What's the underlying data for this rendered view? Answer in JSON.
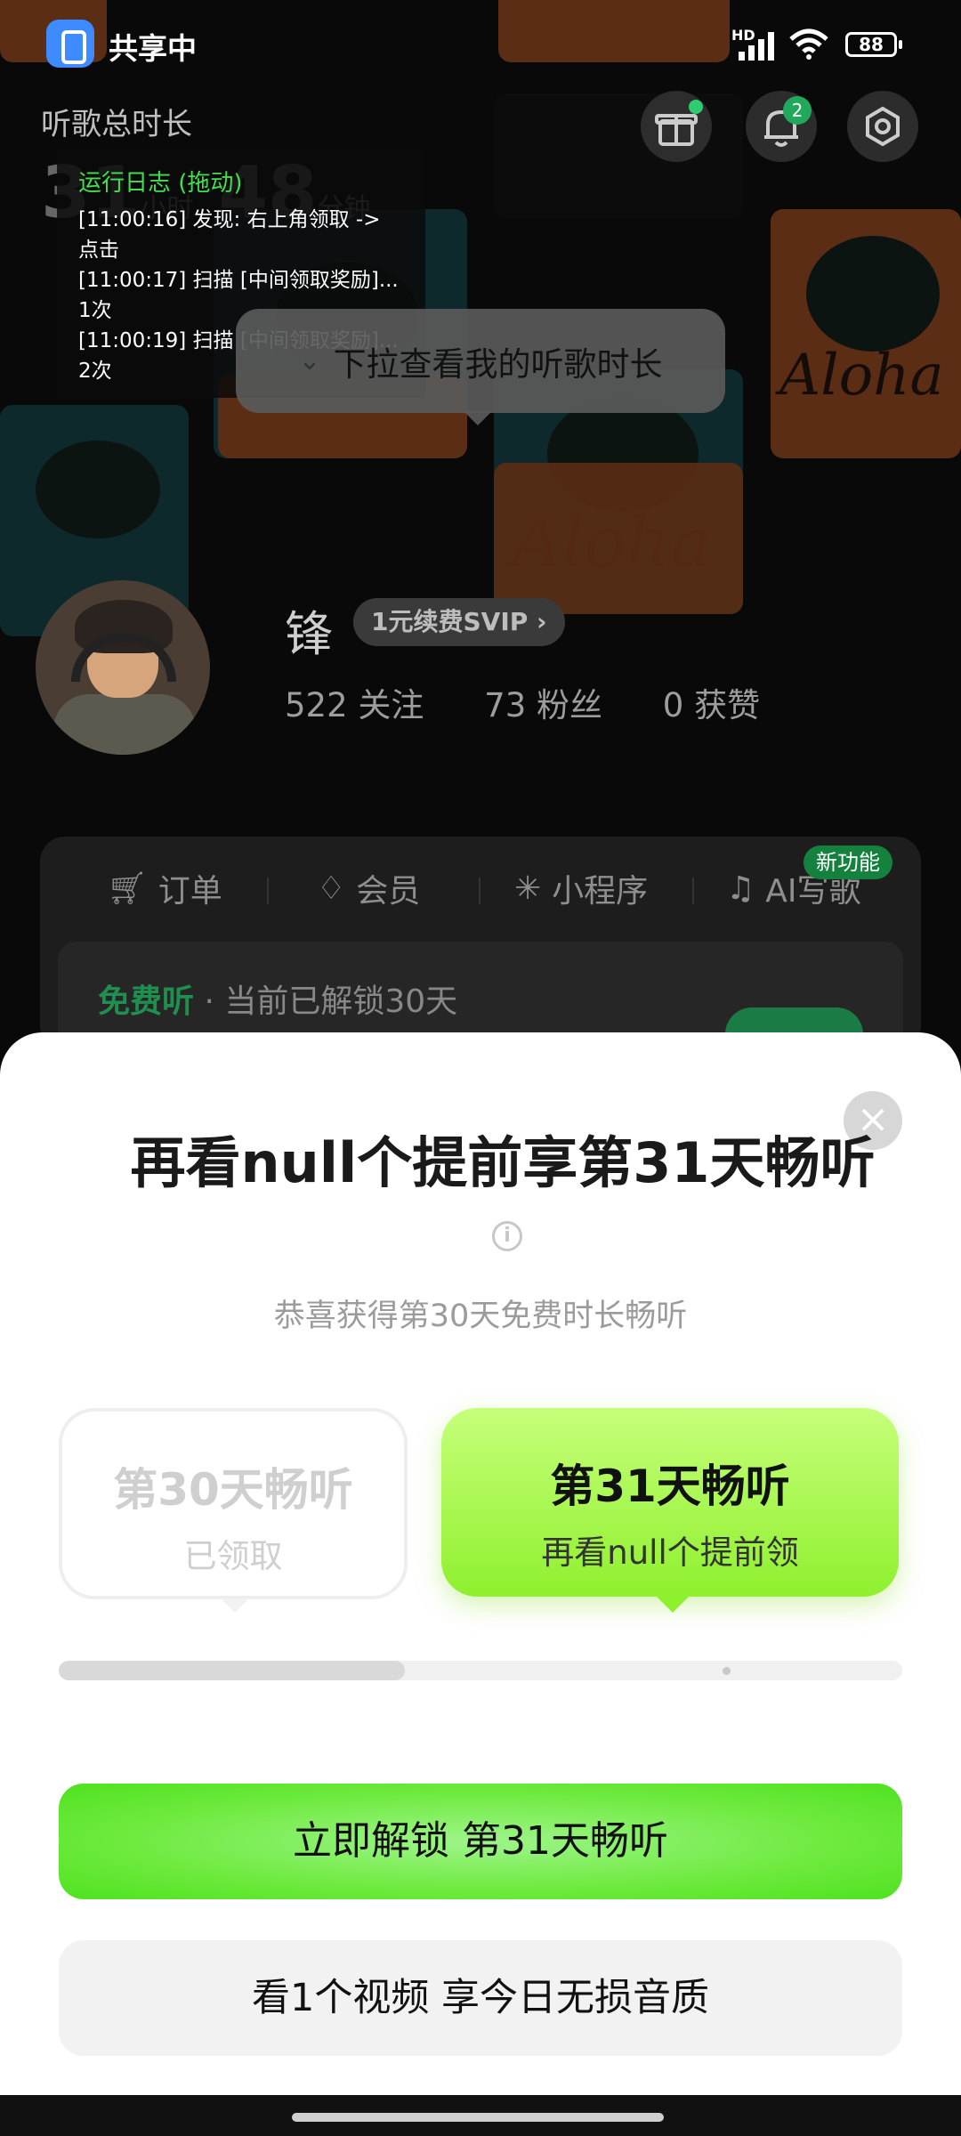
{
  "status_bar": {
    "share_label": "共享中",
    "network": "HD",
    "battery": "88"
  },
  "header": {
    "listen_title": "听歌总时长",
    "hours": "31",
    "hours_unit": "小时",
    "minutes": "48",
    "minutes_unit": "分钟",
    "notification_count": "2",
    "icons": [
      "gift-icon",
      "bell-icon",
      "settings-icon"
    ]
  },
  "log_overlay": {
    "title": "运行日志 (拖动)",
    "lines": [
      "[11:00:16] 发现: 右上角领取 -> 点击",
      "[11:00:17] 扫描 [中间领取奖励]... 1次",
      "[11:00:19] 扫描 [中间领取奖励]... 2次"
    ]
  },
  "tooltip": "下拉查看我的听歌时长",
  "profile": {
    "name": "锋",
    "vip_label": "1元续费SVIP",
    "following": "522 关注",
    "followers": "73 粉丝",
    "likes": "0 获赞"
  },
  "menu": {
    "items": [
      "订单",
      "会员",
      "小程序",
      "AI写歌"
    ],
    "new_badge": "新功能",
    "free_title": "免费听",
    "free_desc": "当前已解锁30天"
  },
  "sheet": {
    "title": "再看null个提前享第31天畅听",
    "congrats": "恭喜获得第30天免费时长畅听",
    "options": [
      {
        "title": "第30天畅听",
        "sub": "已领取"
      },
      {
        "title": "第31天畅听",
        "sub": "再看null个提前领"
      }
    ],
    "progress": 0.41,
    "cta": "立即解锁 第31天畅听",
    "secondary": "看1个视频 享今日无损音质"
  },
  "colors": {
    "accent_green": "#8ff02e",
    "log_green": "#3fe04d",
    "badge_green": "#22a85a"
  }
}
